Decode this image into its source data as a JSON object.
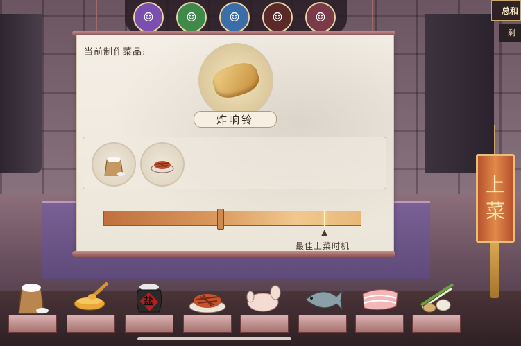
{
  "header": {
    "score_label": "总和",
    "remain_label": "剩"
  },
  "characters": [
    {
      "name": "character-1",
      "color": "#7a4fb0",
      "glyph": "☺"
    },
    {
      "name": "character-2",
      "color": "#3f8a4a",
      "glyph": "☺"
    },
    {
      "name": "character-3",
      "color": "#3a6ea8",
      "glyph": "☺"
    },
    {
      "name": "character-4",
      "color": "#5a2a2a",
      "glyph": "☺"
    },
    {
      "name": "character-5",
      "color": "#7a3a4a",
      "glyph": "☺"
    }
  ],
  "panel": {
    "current_label": "当前制作菜品:",
    "dish_name": "炸响铃",
    "ingredients": [
      {
        "icon": "flour-sack-icon"
      },
      {
        "icon": "shredded-meat-icon"
      }
    ],
    "timing": {
      "best_label": "最佳上菜时机",
      "progress": 0.45,
      "best_point": 0.86
    }
  },
  "serve_button": {
    "label_top": "上",
    "label_bottom": "菜"
  },
  "tray": [
    {
      "icon": "flour-sack-icon"
    },
    {
      "icon": "honey-bowl-icon"
    },
    {
      "icon": "salt-jar-icon",
      "text": "盐"
    },
    {
      "icon": "shredded-meat-icon"
    },
    {
      "icon": "chicken-icon"
    },
    {
      "icon": "fish-icon"
    },
    {
      "icon": "pork-belly-icon"
    },
    {
      "icon": "scallion-ginger-garlic-icon"
    }
  ],
  "colors": {
    "accent": "#e6c07a",
    "button": "#c86a3a"
  }
}
